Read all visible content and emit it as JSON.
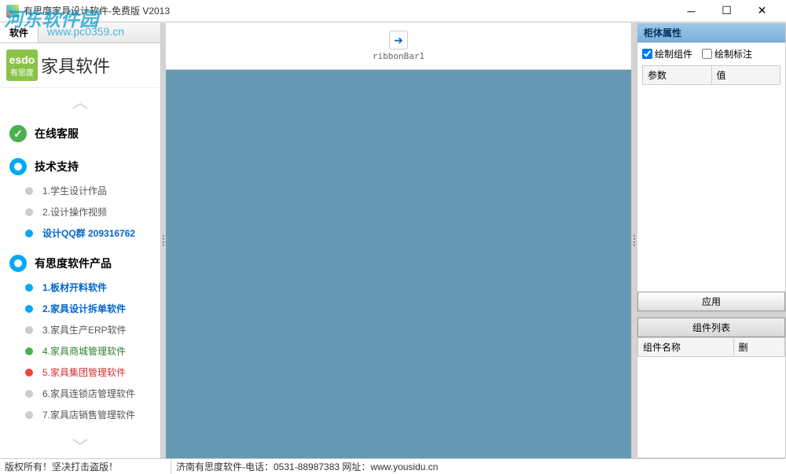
{
  "watermark": {
    "text": "河东软件园",
    "url": "www.pc0359.cn"
  },
  "titlebar": {
    "title": "有思度家具设计软件-免费版 V2013"
  },
  "sidebar_tab": {
    "label": "软件"
  },
  "logo": {
    "badge_top": "esdo",
    "badge_bottom": "有思度",
    "text": "家具软件"
  },
  "sections": {
    "service": {
      "title": "在线客服"
    },
    "support": {
      "title": "技术支持",
      "items": [
        {
          "label": "1.学生设计作品",
          "cls": "text-gray",
          "bullet": "bullet-gray"
        },
        {
          "label": "2.设计操作视频",
          "cls": "text-gray",
          "bullet": "bullet-gray"
        },
        {
          "label": "设计QQ群 209316762",
          "cls": "text-blue",
          "bullet": "bullet-blue"
        }
      ]
    },
    "products": {
      "title": "有思度软件产品",
      "items": [
        {
          "label": "1.板材开料软件",
          "cls": "text-blue",
          "bullet": "bullet-blue"
        },
        {
          "label": "2.家具设计拆单软件",
          "cls": "text-blue",
          "bullet": "bullet-blue"
        },
        {
          "label": "3.家具生产ERP软件",
          "cls": "text-gray",
          "bullet": "bullet-gray"
        },
        {
          "label": "4.家具商城管理软件",
          "cls": "text-green",
          "bullet": "bullet-green"
        },
        {
          "label": "5.家具集团管理软件",
          "cls": "text-red",
          "bullet": "bullet-red"
        },
        {
          "label": "6.家具连锁店管理软件",
          "cls": "text-gray",
          "bullet": "bullet-gray"
        },
        {
          "label": "7.家具店销售管理软件",
          "cls": "text-gray",
          "bullet": "bullet-gray"
        }
      ]
    }
  },
  "ribbon": {
    "label": "ribbonBar1"
  },
  "right_panel": {
    "header": "柜体属性",
    "cb1": "绘制组件",
    "cb2": "绘制标注",
    "col_param": "参数",
    "col_value": "值",
    "apply": "应用",
    "comp_header": "组件列表",
    "col_name": "组件名称",
    "col_del": "删"
  },
  "statusbar": {
    "left": "版权所有！坚决打击盗版！",
    "right": "济南有思度软件-电话：0531-88987383 网址：www.yousidu.cn"
  }
}
